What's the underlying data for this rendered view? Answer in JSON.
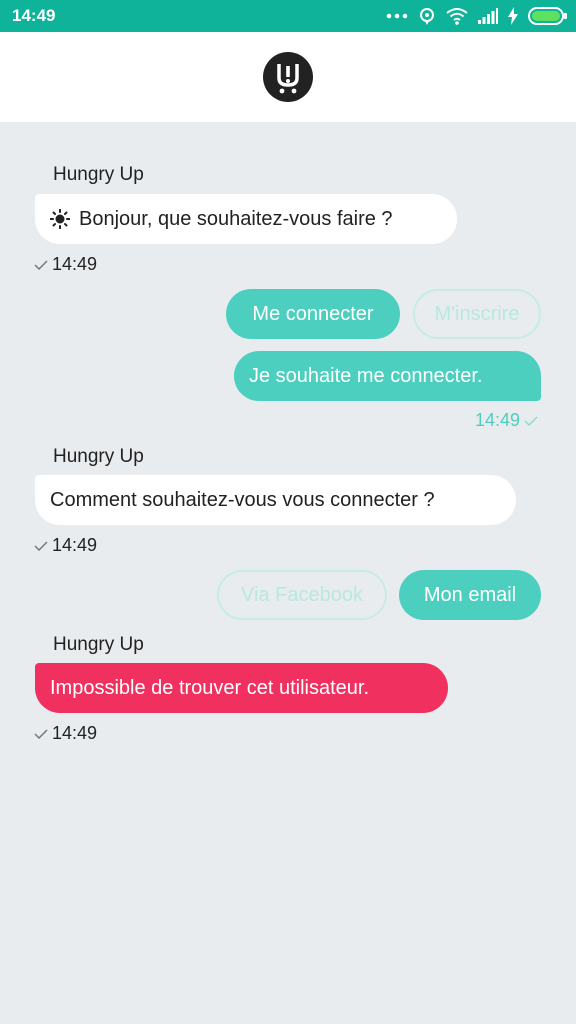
{
  "status_bar": {
    "time": "14:49"
  },
  "messages": [
    {
      "sender": "Hungry Up",
      "text": "Bonjour, que souhaitez-vous faire ?",
      "time": "14:49"
    },
    {
      "quick_replies": [
        "Me connecter",
        "M'inscrire"
      ]
    },
    {
      "user_text": "Je souhaite me connecter.",
      "time": "14:49"
    },
    {
      "sender": "Hungry Up",
      "text": "Comment souhaitez-vous vous connecter ?",
      "time": "14:49"
    },
    {
      "quick_replies": [
        "Via Facebook",
        "Mon email"
      ]
    },
    {
      "sender": "Hungry Up",
      "text": "Impossible de trouver cet utilisateur.",
      "time": "14:49"
    }
  ],
  "colors": {
    "status_bar": "#0fb39a",
    "accent": "#4ccfbf",
    "error": "#f0305f",
    "background": "#e9ecef"
  }
}
